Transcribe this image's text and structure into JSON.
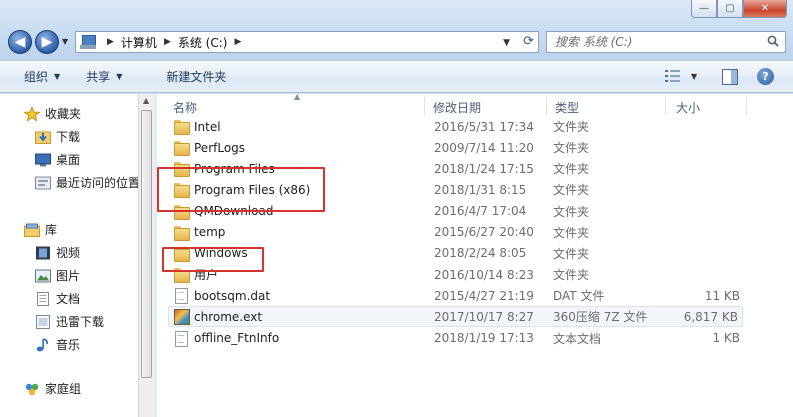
{
  "window": {
    "min_glyph": "—",
    "max_glyph": "▢",
    "close_glyph": "✕"
  },
  "address_bar": {
    "crumbs": [
      "计算机",
      "系统 (C:)"
    ],
    "separator": "▶"
  },
  "search": {
    "placeholder": "搜索 系统 (C:)"
  },
  "toolbar": {
    "organize": "组织",
    "share": "共享",
    "new_folder": "新建文件夹"
  },
  "nav": {
    "favorites": {
      "label": "收藏夹",
      "items": [
        "下载",
        "桌面",
        "最近访问的位置"
      ]
    },
    "libraries": {
      "label": "库",
      "items": [
        "视频",
        "图片",
        "文档",
        "迅雷下载",
        "音乐"
      ]
    },
    "homegroup": {
      "label": "家庭组"
    }
  },
  "columns": {
    "name": "名称",
    "modified": "修改日期",
    "type": "类型",
    "size": "大小"
  },
  "files": [
    {
      "name": "Intel",
      "modified": "2016/5/31 17:34",
      "type": "文件夹",
      "size": "",
      "icon": "folder-icon"
    },
    {
      "name": "PerfLogs",
      "modified": "2009/7/14 11:20",
      "type": "文件夹",
      "size": "",
      "icon": "folder-icon"
    },
    {
      "name": "Program Files",
      "modified": "2018/1/24 17:15",
      "type": "文件夹",
      "size": "",
      "icon": "folder-icon"
    },
    {
      "name": "Program Files (x86)",
      "modified": "2018/1/31 8:15",
      "type": "文件夹",
      "size": "",
      "icon": "folder-icon"
    },
    {
      "name": "QMDownload",
      "modified": "2016/4/7 17:04",
      "type": "文件夹",
      "size": "",
      "icon": "folder-icon"
    },
    {
      "name": "temp",
      "modified": "2015/6/27 20:40",
      "type": "文件夹",
      "size": "",
      "icon": "folder-icon"
    },
    {
      "name": "Windows",
      "modified": "2018/2/24 8:05",
      "type": "文件夹",
      "size": "",
      "icon": "folder-icon"
    },
    {
      "name": "用户",
      "modified": "2016/10/14 8:23",
      "type": "文件夹",
      "size": "",
      "icon": "folder-icon"
    },
    {
      "name": "bootsqm.dat",
      "modified": "2015/4/27 21:19",
      "type": "DAT 文件",
      "size": "11 KB",
      "icon": "document-icon"
    },
    {
      "name": "chrome.ext",
      "modified": "2017/10/17 8:27",
      "type": "360压缩 7Z 文件",
      "size": "6,817 KB",
      "icon": "archive-icon"
    },
    {
      "name": "offline_FtnInfo",
      "modified": "2018/1/19 17:13",
      "type": "文本文档",
      "size": "1 KB",
      "icon": "document-icon"
    }
  ],
  "highlight_color": "#d6322e"
}
